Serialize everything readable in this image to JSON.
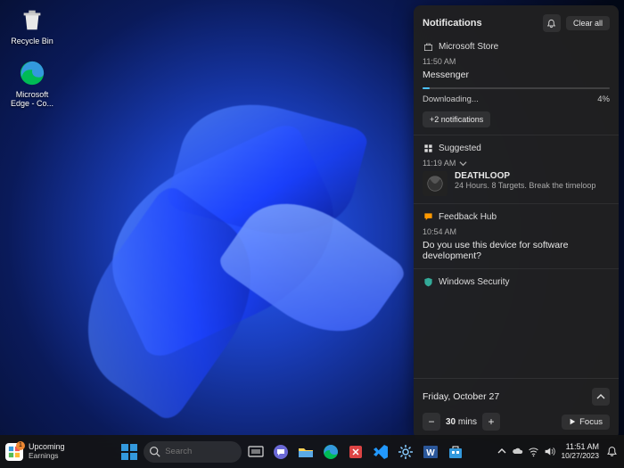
{
  "desktop": {
    "icons": [
      {
        "name": "Recycle Bin"
      },
      {
        "name": "Microsoft Edge - Co..."
      }
    ]
  },
  "panel": {
    "title": "Notifications",
    "clear_all": "Clear all",
    "groups": {
      "store": {
        "app": "Microsoft Store",
        "time": "11:50 AM",
        "title": "Messenger",
        "status": "Downloading...",
        "percent_text": "4%",
        "percent": 4,
        "more": "+2 notifications"
      },
      "suggested": {
        "header": "Suggested",
        "time": "11:19 AM",
        "game_title": "DEATHLOOP",
        "game_desc": "24 Hours. 8 Targets. Break the timeloop"
      },
      "feedback": {
        "app": "Feedback Hub",
        "time": "10:54 AM",
        "text": "Do you use this device for software development?"
      },
      "security": {
        "app": "Windows Security"
      }
    },
    "focus": {
      "date": "Friday, October 27",
      "value": "30",
      "unit": "mins",
      "button": "Focus"
    }
  },
  "taskbar": {
    "widget": {
      "badge": "1",
      "line1": "Upcoming",
      "line2": "Earnings"
    },
    "search_placeholder": "Search",
    "clock": {
      "time": "11:51 AM",
      "date": "10/27/2023"
    }
  }
}
